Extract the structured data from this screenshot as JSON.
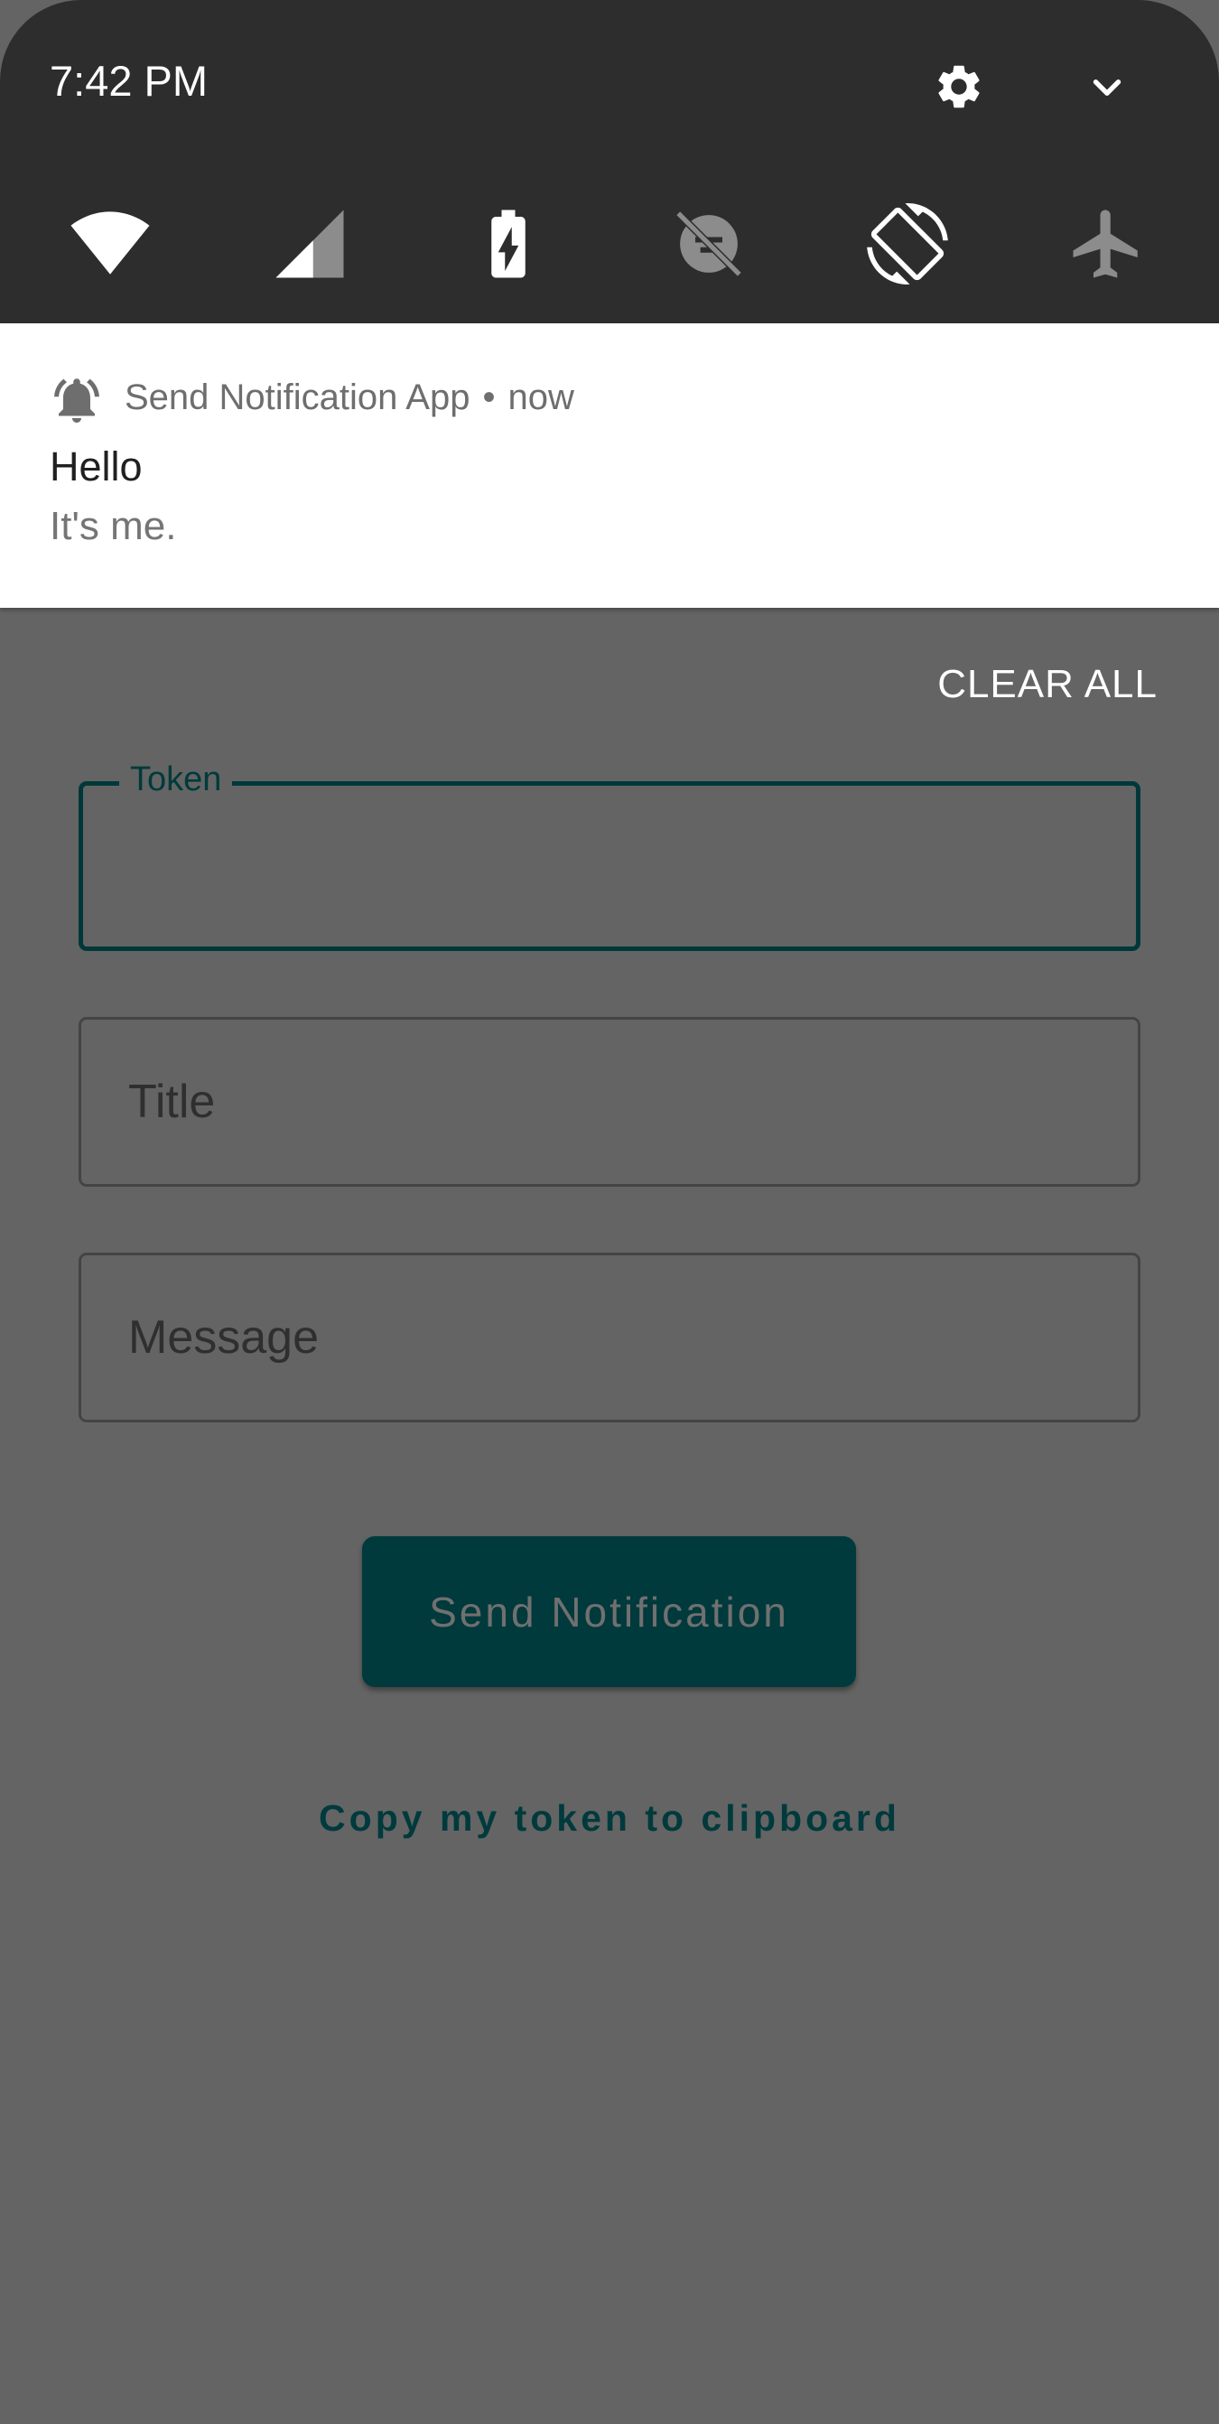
{
  "status_bar": {
    "time": "7:42 PM"
  },
  "quick_settings": {
    "tiles": [
      {
        "name": "wifi-icon",
        "state": "on"
      },
      {
        "name": "cellular-signal-icon",
        "state": "on"
      },
      {
        "name": "battery-saver-icon",
        "state": "on"
      },
      {
        "name": "data-saver-icon",
        "state": "off"
      },
      {
        "name": "auto-rotate-icon",
        "state": "on"
      },
      {
        "name": "airplane-mode-icon",
        "state": "off"
      }
    ],
    "tile_colors": {
      "on": "#ffffff",
      "off": "#8c8c8c"
    }
  },
  "notification": {
    "app_name": "Send Notification App",
    "separator": "•",
    "time": "now",
    "title": "Hello",
    "text": "It's me."
  },
  "clear_all_label": "CLEAR ALL",
  "form": {
    "token": {
      "label": "Token",
      "value": ""
    },
    "title": {
      "placeholder": "Title",
      "value": ""
    },
    "message": {
      "placeholder": "Message",
      "value": ""
    }
  },
  "send_button_label": "Send Notification",
  "copy_token_label": "Copy my token to clipboard",
  "colors": {
    "accent": "#013a3c",
    "scrim": "#646464",
    "panel": "#2d2d2d"
  }
}
